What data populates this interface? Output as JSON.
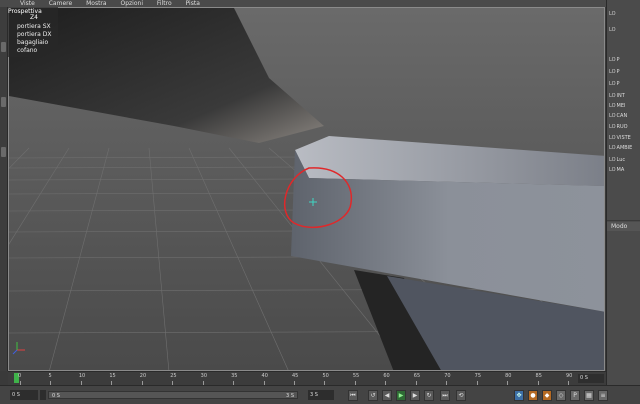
{
  "menubar": {
    "items": [
      "Viste",
      "Camere",
      "Mostra",
      "Opzioni",
      "Filtro",
      "Pista"
    ]
  },
  "viewport": {
    "label": "Prospettiva",
    "hud": {
      "selected": "Z4",
      "items": [
        "portiera SX",
        "portiera DX",
        "bagagliaio",
        "cofano"
      ]
    },
    "annotation": {
      "type": "red-freehand-circle",
      "color": "#e0282a"
    },
    "cursor_icon": "crosshair-plus-icon",
    "cursor_color": "#3fd6c3",
    "axis_gizmo": [
      "x",
      "y",
      "z"
    ]
  },
  "right_panel": {
    "items": [
      {
        "label": "LO",
        "suffix": ""
      },
      {
        "label": "LO",
        "suffix": "P"
      },
      {
        "label": "LO",
        "suffix": "P"
      },
      {
        "label": "LO",
        "suffix": "P"
      },
      {
        "label": "LO",
        "suffix": "P"
      },
      {
        "label": "LO",
        "suffix": "INT"
      },
      {
        "label": "LO",
        "suffix": "MEI"
      },
      {
        "label": "LO",
        "suffix": "CAN"
      },
      {
        "label": "LO",
        "suffix": "RUO"
      },
      {
        "label": "LO",
        "suffix": "VISTE"
      },
      {
        "label": "LO",
        "suffix": "AMBIE"
      },
      {
        "label": "LO",
        "suffix": "Luc"
      },
      {
        "label": "LO",
        "suffix": "MA"
      }
    ],
    "modo_label": "Modo"
  },
  "timeline": {
    "ticks": [
      "0",
      "5",
      "10",
      "15",
      "20",
      "25",
      "30",
      "35",
      "40",
      "45",
      "50",
      "55",
      "60",
      "65",
      "70",
      "75",
      "80",
      "85",
      "90"
    ],
    "current_frame": "0 S",
    "playhead_color": "#3fb24a"
  },
  "bottombar": {
    "start_field": "0 S",
    "min_field": "0 S",
    "slider_left": "0 S",
    "slider_right": "3 S",
    "end_field": "3 S",
    "buttons": [
      {
        "name": "go-start-button",
        "glyph": "⏮"
      },
      {
        "name": "prev-key-button",
        "glyph": "↺"
      },
      {
        "name": "prev-frame-button",
        "glyph": "◀"
      },
      {
        "name": "play-button",
        "glyph": "▶"
      },
      {
        "name": "next-frame-button",
        "glyph": "▶"
      },
      {
        "name": "next-key-button",
        "glyph": "↻"
      },
      {
        "name": "go-end-button",
        "glyph": "⏭"
      },
      {
        "name": "loop-button",
        "glyph": "⟲"
      },
      {
        "name": "move-tool-button",
        "glyph": "✥"
      },
      {
        "name": "record-button",
        "glyph": "●"
      },
      {
        "name": "key-button",
        "glyph": "◆"
      },
      {
        "name": "autokey-button",
        "glyph": "◇"
      },
      {
        "name": "pos-button",
        "glyph": "P"
      },
      {
        "name": "grid-button",
        "glyph": "▦"
      },
      {
        "name": "menu-button",
        "glyph": "≡"
      }
    ]
  }
}
